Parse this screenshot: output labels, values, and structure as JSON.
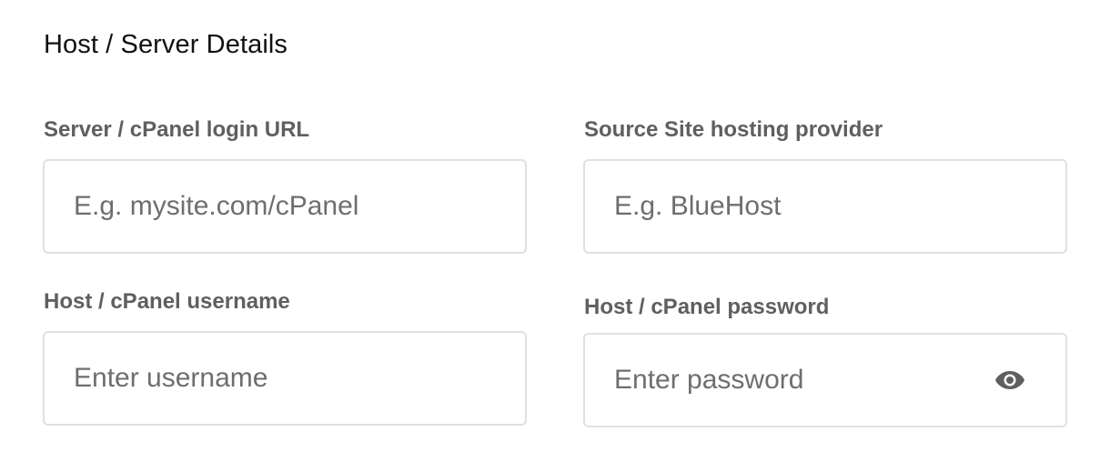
{
  "section": {
    "title": "Host / Server Details"
  },
  "fields": {
    "server_url": {
      "label": "Server / cPanel login URL",
      "placeholder": "E.g. mysite.com/cPanel",
      "value": ""
    },
    "hosting_provider": {
      "label": "Source Site hosting provider",
      "placeholder": "E.g. BlueHost",
      "value": ""
    },
    "username": {
      "label": "Host / cPanel username",
      "placeholder": "Enter username",
      "value": ""
    },
    "password": {
      "label": "Host / cPanel password",
      "placeholder": "Enter password",
      "value": "",
      "toggle_icon": "eye-icon"
    }
  },
  "colors": {
    "title": "#111111",
    "label": "#5f5f5f",
    "placeholder": "#6e6e6e",
    "border": "#e0e0e0",
    "icon": "#5f5f5f"
  }
}
